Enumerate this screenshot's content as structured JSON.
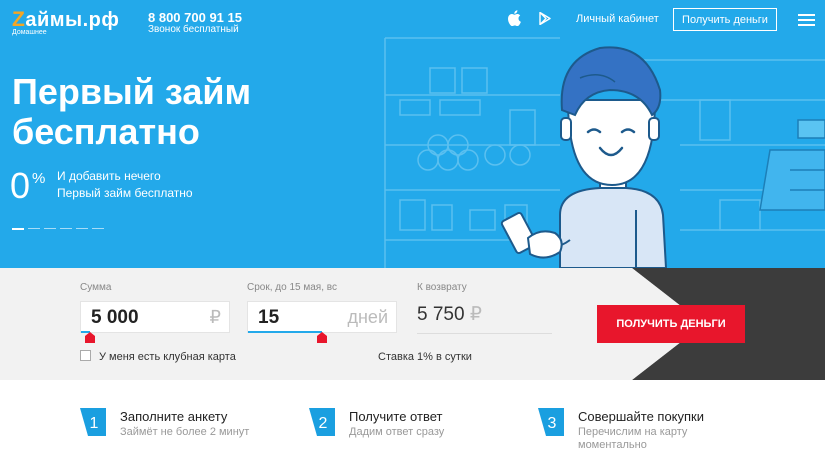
{
  "header": {
    "logo_z": "Z",
    "logo_text": "аймы.рф",
    "logo_sub": "Домашнее",
    "phone": "8 800 700 91 15",
    "phone_sub": "Звонок бесплатный",
    "cabinet": "Личный кабинет",
    "get_money": "Получить деньги"
  },
  "hero": {
    "title_line1": "Первый займ",
    "title_line2": "бесплатно",
    "zero": "0",
    "percent": "%",
    "slide_title": "И добавить нечего",
    "slide_sub": "Первый займ бесплатно",
    "slides_count": 6,
    "active_slide": 1
  },
  "calculator": {
    "sum_label": "Сумма",
    "sum_value": "5 000",
    "sum_unit": "₽",
    "term_label": "Срок, до 15 мая, вс",
    "term_value": "15",
    "term_unit": "дней",
    "return_label": "К возврату",
    "return_value": "5 750",
    "return_unit": "₽",
    "button": "ПОЛУЧИТЬ ДЕНЬГИ",
    "checkbox_label": "У меня есть клубная карта",
    "checkbox_checked": false,
    "rate": "Ставка 1% в сутки",
    "sum_slider_fraction": 0.06,
    "term_slider_fraction": 0.49
  },
  "steps": [
    {
      "num": "1",
      "title": "Заполните анкету",
      "sub": "Займёт не более 2 минут"
    },
    {
      "num": "2",
      "title": "Получите ответ",
      "sub": "Дадим ответ сразу"
    },
    {
      "num": "3",
      "title": "Совершайте покупки",
      "sub": "Перечислим на карту моментально"
    }
  ],
  "colors": {
    "hero_bg": "#23a9ea",
    "accent_red": "#e8162c",
    "step_blue": "#1a9fe0",
    "dark_corner": "#3c3c3c"
  }
}
